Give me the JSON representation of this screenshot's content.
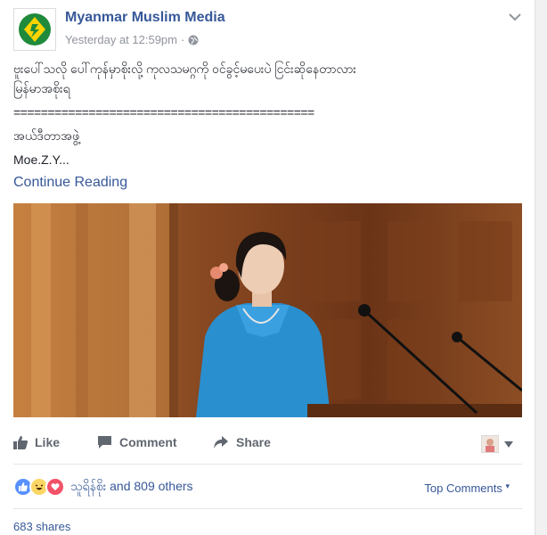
{
  "post": {
    "page_name": "Myanmar Muslim Media",
    "timestamp": "Yesterday at 12:59pm",
    "separator": "·",
    "audience_icon": "globe-icon",
    "text_lines": [
      "ဗူးပေါ်သလို ပေါ်ကုန်မှာစိုးလို့ ကုလသမဂ္ဂကို ဝင်ခွင့်မပေးပဲ ငြင်းဆိုနေတာလား",
      "မြန်မာအစိုးရ",
      "============================================",
      "အယ်ဒီတာအဖွဲ့",
      "Moe.Z.Y..."
    ],
    "continue_label": "Continue Reading"
  },
  "actions": {
    "like": "Like",
    "comment": "Comment",
    "share": "Share"
  },
  "reactions": {
    "types": [
      "like-icon",
      "haha-icon",
      "love-icon"
    ],
    "text": "သူရိန်စိုး and 809 others",
    "top_comments": "Top Comments",
    "top_comments_caret": "▾"
  },
  "shares": "683 shares",
  "colors": {
    "link": "#365899",
    "like_blue": "#5890ff",
    "love_red": "#f25268",
    "haha_yellow": "#fcd664",
    "logo_green": "#1f8a3b"
  }
}
